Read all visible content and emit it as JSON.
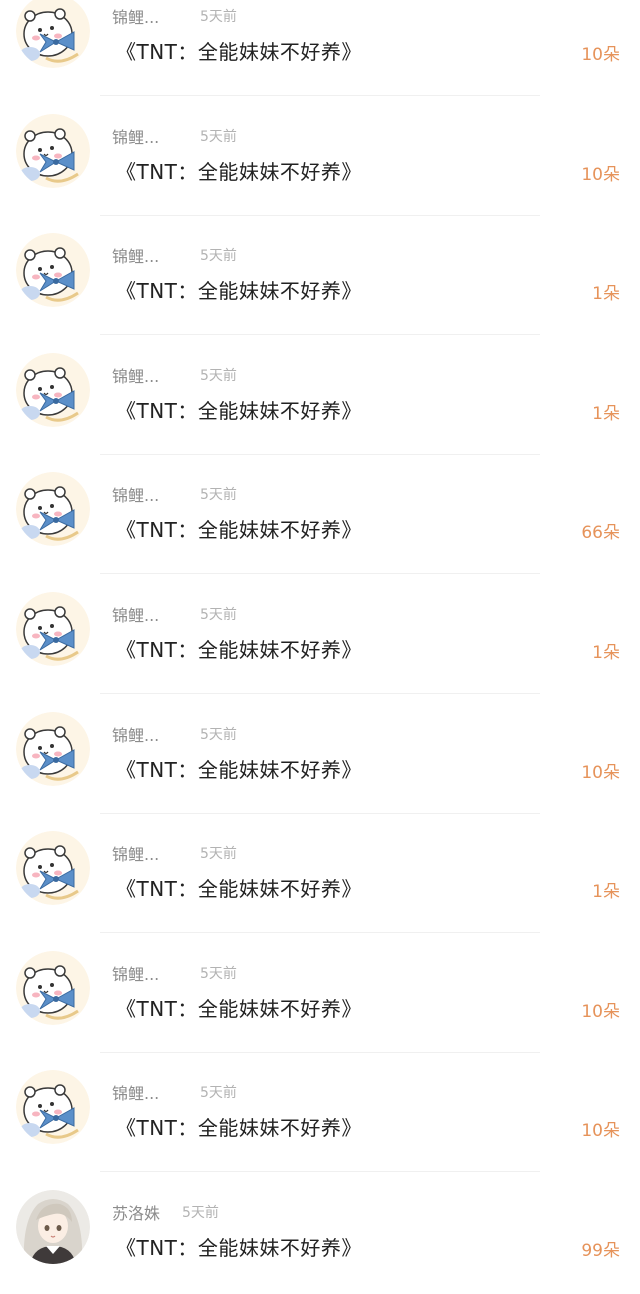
{
  "colors": {
    "background": "#ffffff",
    "name_text": "#8c8c8c",
    "time_text": "#b3b3b3",
    "title_text": "#222222",
    "amount_text": "#e6935a",
    "divider": "#f0f0f0"
  },
  "entries": [
    {
      "avatar": "hamster-avatar-icon",
      "name": "锦鲤...",
      "time": "5天前",
      "title": "《TNT：全能妹妹不好养》",
      "amount": "10朵"
    },
    {
      "avatar": "hamster-avatar-icon",
      "name": "锦鲤...",
      "time": "5天前",
      "title": "《TNT：全能妹妹不好养》",
      "amount": "10朵"
    },
    {
      "avatar": "hamster-avatar-icon",
      "name": "锦鲤...",
      "time": "5天前",
      "title": "《TNT：全能妹妹不好养》",
      "amount": "1朵"
    },
    {
      "avatar": "hamster-avatar-icon",
      "name": "锦鲤...",
      "time": "5天前",
      "title": "《TNT：全能妹妹不好养》",
      "amount": "1朵"
    },
    {
      "avatar": "hamster-avatar-icon",
      "name": "锦鲤...",
      "time": "5天前",
      "title": "《TNT：全能妹妹不好养》",
      "amount": "66朵"
    },
    {
      "avatar": "hamster-avatar-icon",
      "name": "锦鲤...",
      "time": "5天前",
      "title": "《TNT：全能妹妹不好养》",
      "amount": "1朵"
    },
    {
      "avatar": "hamster-avatar-icon",
      "name": "锦鲤...",
      "time": "5天前",
      "title": "《TNT：全能妹妹不好养》",
      "amount": "10朵"
    },
    {
      "avatar": "hamster-avatar-icon",
      "name": "锦鲤...",
      "time": "5天前",
      "title": "《TNT：全能妹妹不好养》",
      "amount": "1朵"
    },
    {
      "avatar": "hamster-avatar-icon",
      "name": "锦鲤...",
      "time": "5天前",
      "title": "《TNT：全能妹妹不好养》",
      "amount": "10朵"
    },
    {
      "avatar": "hamster-avatar-icon",
      "name": "锦鲤...",
      "time": "5天前",
      "title": "《TNT：全能妹妹不好养》",
      "amount": "10朵"
    },
    {
      "avatar": "anime-girl-avatar-icon",
      "name": "苏洛姝",
      "time": "5天前",
      "title": "《TNT：全能妹妹不好养》",
      "amount": "99朵"
    }
  ]
}
